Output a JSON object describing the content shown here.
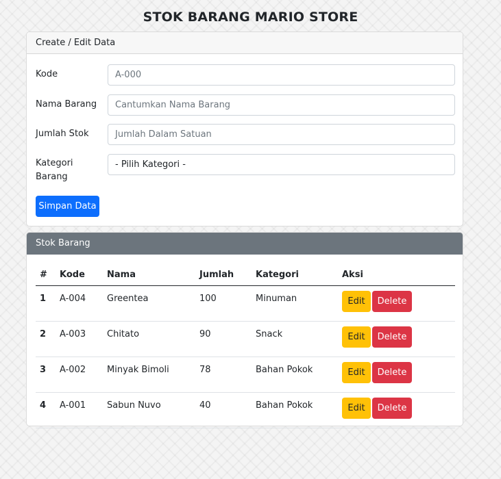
{
  "page": {
    "title": "STOK BARANG MARIO STORE"
  },
  "form": {
    "header": "Create / Edit Data",
    "kode": {
      "label": "Kode",
      "placeholder": "A-000"
    },
    "nama": {
      "label": "Nama Barang",
      "placeholder": "Cantumkan Nama Barang"
    },
    "jumlah": {
      "label": "Jumlah Stok",
      "placeholder": "Jumlah Dalam Satuan"
    },
    "kategori": {
      "label": "Kategori Barang",
      "selected": "- Pilih Kategori -"
    },
    "submit_label": "Simpan Data"
  },
  "table": {
    "header": "Stok Barang",
    "columns": [
      "#",
      "Kode",
      "Nama",
      "Jumlah",
      "Kategori",
      "Aksi"
    ],
    "rows": [
      {
        "no": "1",
        "kode": "A-004",
        "nama": "Greentea",
        "jumlah": "100",
        "kategori": "Minuman"
      },
      {
        "no": "2",
        "kode": "A-003",
        "nama": "Chitato",
        "jumlah": "90",
        "kategori": "Snack"
      },
      {
        "no": "3",
        "kode": "A-002",
        "nama": "Minyak Bimoli",
        "jumlah": "78",
        "kategori": "Bahan Pokok"
      },
      {
        "no": "4",
        "kode": "A-001",
        "nama": "Sabun Nuvo",
        "jumlah": "40",
        "kategori": "Bahan Pokok"
      }
    ],
    "edit_label": "Edit",
    "delete_label": "Delete"
  },
  "colors": {
    "primary": "#0d6efd",
    "warning": "#ffc107",
    "danger": "#dc3545",
    "secondary": "#6c757d"
  }
}
